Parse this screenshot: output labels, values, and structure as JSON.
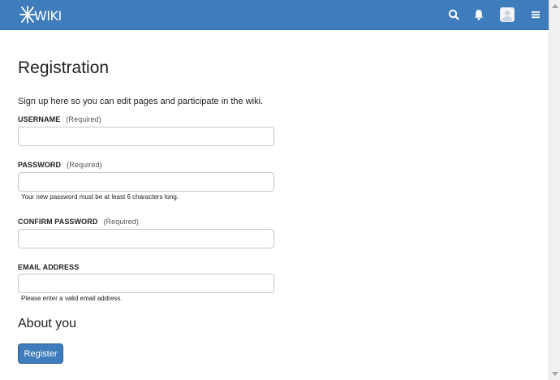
{
  "header": {
    "logo_text": "XWIKI",
    "icons": [
      "search-icon",
      "bell-icon",
      "avatar",
      "menu-icon"
    ],
    "brand_color": "#3e7cbb"
  },
  "page": {
    "title": "Registration",
    "intro": "Sign up here so you can edit pages and participate in the wiki."
  },
  "form": {
    "username": {
      "label": "USERNAME",
      "required": "(Required)",
      "value": "",
      "placeholder": ""
    },
    "password": {
      "label": "PASSWORD",
      "required": "(Required)",
      "value": "",
      "placeholder": "",
      "hint": "Your new password must be at least 6 characters long."
    },
    "confirm_password": {
      "label": "CONFIRM PASSWORD",
      "required": "(Required)",
      "value": "",
      "placeholder": ""
    },
    "email": {
      "label": "EMAIL ADDRESS",
      "value": "",
      "placeholder": "",
      "hint": "Please enter a valid email address."
    }
  },
  "about": {
    "heading": "About you"
  },
  "actions": {
    "register_label": "Register"
  }
}
